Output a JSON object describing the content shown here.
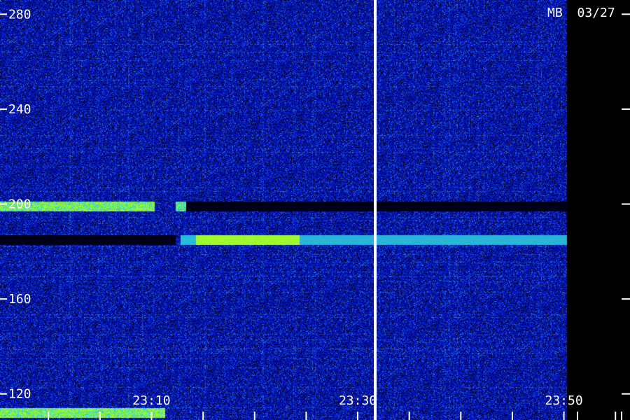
{
  "badge": {
    "station": "MB",
    "date": "03/27"
  },
  "colors": {
    "background": "#000000",
    "noise_low": "#0a0a9a",
    "noise_high": "#3a6aff",
    "signal_cyan": "#30d0e0",
    "signal_green": "#80ff20",
    "axis": "#ffffff"
  },
  "chart_data": {
    "type": "heatmap",
    "title": "",
    "xlabel": "",
    "ylabel": "",
    "y_ticks": [
      {
        "value": 120,
        "label": "120"
      },
      {
        "value": 160,
        "label": "160"
      },
      {
        "value": 200,
        "label": "200"
      },
      {
        "value": 240,
        "label": "240"
      },
      {
        "value": 280,
        "label": "280"
      }
    ],
    "ylim": [
      109,
      286
    ],
    "x_ticks": [
      {
        "label": "23:10",
        "minute": 10
      },
      {
        "label": "23:30",
        "minute": 30
      },
      {
        "label": "23:50",
        "minute": 50
      }
    ],
    "x_minor_ticks_minutes": [
      0,
      5,
      10,
      15,
      20,
      25,
      30,
      35,
      40,
      45,
      50,
      55
    ],
    "time_range_minutes": [
      -4.7,
      50.3
    ],
    "cursor_minute": 31.7,
    "bands": [
      {
        "name": "",
        "y": 199,
        "t_start": -4.7,
        "t_end": 10.3,
        "intensity": 0.9
      },
      {
        "name": "",
        "y": 199,
        "t_start": 12.3,
        "t_end": 13.3,
        "intensity": 0.85
      },
      {
        "name": "",
        "y": 185,
        "t_start": 12.8,
        "t_end": 14.3,
        "intensity": 0.55
      },
      {
        "name": "",
        "y": 185,
        "t_start": 14.3,
        "t_end": 24.3,
        "intensity": 1.0
      },
      {
        "name": "",
        "y": 185,
        "t_start": 24.3,
        "t_end": 50.3,
        "intensity": 0.45
      },
      {
        "name": "",
        "y": 112,
        "t_start": -4.7,
        "t_end": 11.3,
        "intensity": 0.9
      }
    ],
    "dark_bands": [
      {
        "y": 185,
        "t_start": -4.7,
        "t_end": 12.3
      },
      {
        "y": 199,
        "t_start": 13.3,
        "t_end": 50.3
      }
    ]
  }
}
